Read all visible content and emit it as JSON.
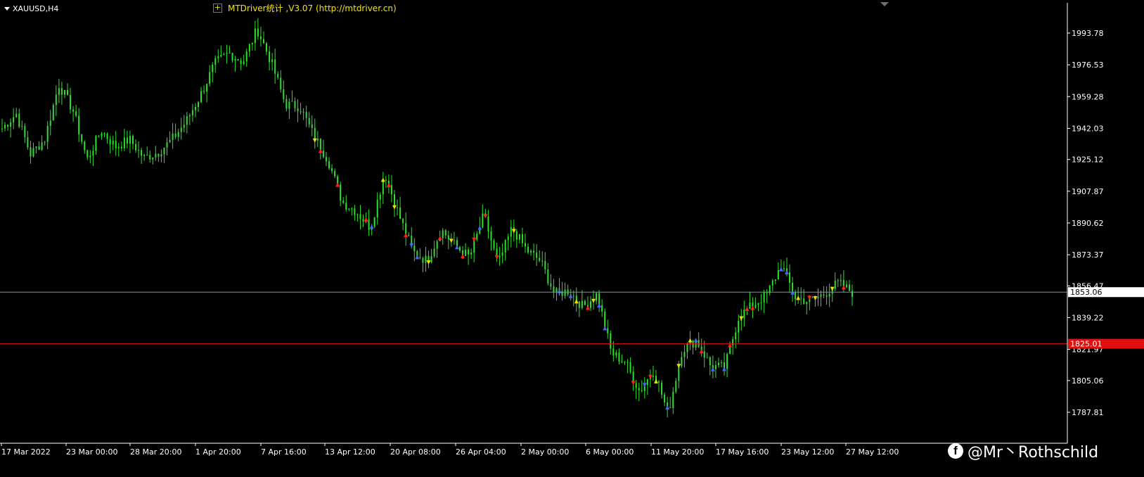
{
  "window": {
    "symbol_title": "XAUUSD,H4",
    "indicator_title": "MTDriver统计 ,V3.07 (http://mtdriver.cn)",
    "watermark": "@Mr丶Rothschild"
  },
  "colors": {
    "background": "#000000",
    "candle": "#2ee02e",
    "bid_line": "#7f93a8",
    "level_line": "#e01010",
    "axis_text": "#ffffff",
    "indicator_text": "#f5e400",
    "marker_red": "#ff2020",
    "marker_blue": "#4466ff",
    "marker_yellow": "#f0e000"
  },
  "price_axis": {
    "labels": [
      "1993.78",
      "1976.53",
      "1959.28",
      "1942.03",
      "1925.12",
      "1907.87",
      "1890.62",
      "1873.37",
      "1856.47",
      "1839.22",
      "1821.97",
      "1805.06",
      "1787.81"
    ],
    "current_price": "1853.06",
    "level_price": "1825.01"
  },
  "time_axis": {
    "labels": [
      "17 Mar 2022",
      "23 Mar 00:00",
      "28 Mar 20:00",
      "1 Apr 20:00",
      "7 Apr 16:00",
      "13 Apr 12:00",
      "20 Apr 08:00",
      "26 Apr 04:00",
      "2 May 00:00",
      "6 May 00:00",
      "11 May 20:00",
      "17 May 16:00",
      "23 May 12:00",
      "27 May 12:00"
    ]
  },
  "chart_data": {
    "type": "line",
    "title": "XAUUSD,H4",
    "timeframe": "H4",
    "ylim": [
      1787.81,
      1998.0
    ],
    "grid": false,
    "x": [
      "17 Mar 2022",
      "23 Mar 00:00",
      "28 Mar 20:00",
      "1 Apr 20:00",
      "7 Apr 16:00",
      "13 Apr 12:00",
      "20 Apr 08:00",
      "26 Apr 04:00",
      "2 May 00:00",
      "6 May 00:00",
      "11 May 20:00",
      "17 May 16:00",
      "23 May 12:00",
      "27 May 12:00"
    ],
    "series": [
      {
        "name": "XAUUSD,H4",
        "values": [
          1942,
          1950,
          1928,
          1936,
          1966,
          1952,
          1925,
          1941,
          1932,
          1936,
          1926,
          1929,
          1936,
          1946,
          1960,
          1977,
          1983,
          1978,
          1996,
          1978,
          1955,
          1954,
          1938,
          1925,
          1902,
          1897,
          1888,
          1918,
          1895,
          1875,
          1870,
          1887,
          1878,
          1872,
          1895,
          1868,
          1888,
          1876,
          1870,
          1852,
          1854,
          1845,
          1852,
          1820,
          1815,
          1799,
          1811,
          1787,
          1822,
          1827,
          1813,
          1812,
          1840,
          1846,
          1852,
          1868,
          1850,
          1848,
          1852,
          1858,
          1853
        ]
      }
    ],
    "horizontal_lines": [
      1853.06,
      1825.01
    ]
  }
}
